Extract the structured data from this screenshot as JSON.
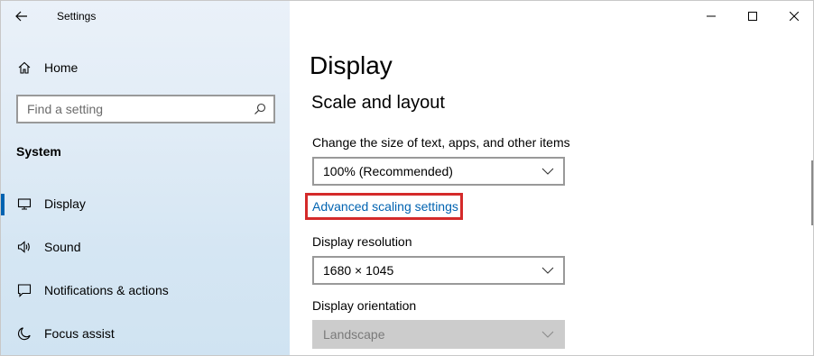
{
  "window": {
    "title": "Settings"
  },
  "sidebar": {
    "home_label": "Home",
    "search_placeholder": "Find a setting",
    "section_heading": "System",
    "items": [
      {
        "label": "Display",
        "icon": "monitor-icon",
        "active": true
      },
      {
        "label": "Sound",
        "icon": "speaker-icon",
        "active": false
      },
      {
        "label": "Notifications & actions",
        "icon": "notification-icon",
        "active": false
      },
      {
        "label": "Focus assist",
        "icon": "moon-icon",
        "active": false
      }
    ]
  },
  "main": {
    "page_title": "Display",
    "section_title": "Scale and layout",
    "scale": {
      "label": "Change the size of text, apps, and other items",
      "value": "100% (Recommended)"
    },
    "advanced_link": "Advanced scaling settings",
    "resolution": {
      "label": "Display resolution",
      "value": "1680 × 1045"
    },
    "orientation": {
      "label": "Display orientation",
      "value": "Landscape",
      "disabled": true
    }
  },
  "colors": {
    "accent": "#0063b1",
    "highlight_box": "#d42a2a",
    "sidebar_bg": "#dbe8f4"
  }
}
